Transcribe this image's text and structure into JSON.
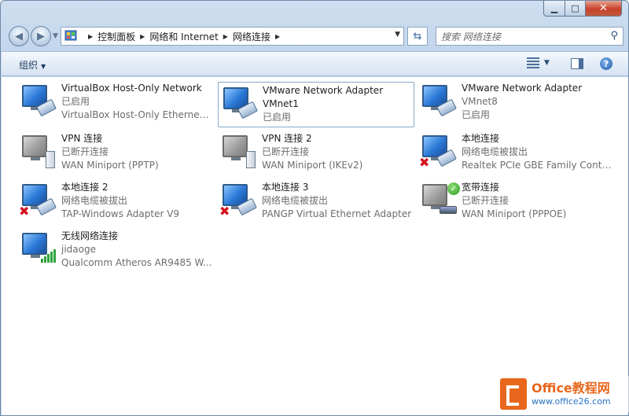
{
  "window": {
    "caption": {
      "minimize": "▁",
      "maximize": "□",
      "close": "✕"
    }
  },
  "navbar": {
    "back_icon": "◀",
    "forward_icon": "▶",
    "breadcrumb": [
      "控制面板",
      "网络和 Internet",
      "网络连接"
    ],
    "search_placeholder": "搜索 网络连接"
  },
  "toolbar": {
    "organize_label": "组织"
  },
  "connections": [
    {
      "name": "VirtualBox Host-Only Network",
      "status": "已启用",
      "device": "VirtualBox Host-Only Ethernet ...",
      "icon": "network-adapter-icon",
      "state": "enabled"
    },
    {
      "name": "VMware Network Adapter",
      "status": "VMnet1",
      "device": "已启用",
      "icon": "network-adapter-icon",
      "state": "enabled",
      "selected": true
    },
    {
      "name": "VMware Network Adapter",
      "status": "VMnet8",
      "device": "已启用",
      "icon": "network-adapter-icon",
      "state": "enabled"
    },
    {
      "name": "VPN 连接",
      "status": "已断开连接",
      "device": "WAN Miniport (PPTP)",
      "icon": "vpn-icon",
      "state": "disconnected"
    },
    {
      "name": "VPN 连接 2",
      "status": "已断开连接",
      "device": "WAN Miniport (IKEv2)",
      "icon": "vpn-icon",
      "state": "disconnected"
    },
    {
      "name": "本地连接",
      "status": "网络电缆被拔出",
      "device": "Realtek PCIe GBE Family Contr...",
      "icon": "network-adapter-icon",
      "state": "unplugged"
    },
    {
      "name": "本地连接 2",
      "status": "网络电缆被拔出",
      "device": "TAP-Windows Adapter V9",
      "icon": "network-adapter-icon",
      "state": "unplugged"
    },
    {
      "name": "本地连接 3",
      "status": "网络电缆被拔出",
      "device": "PANGP Virtual Ethernet Adapter",
      "icon": "network-adapter-icon",
      "state": "unplugged"
    },
    {
      "name": "宽带连接",
      "status": "已断开连接",
      "device": "WAN Miniport (PPPOE)",
      "icon": "broadband-icon",
      "state": "connected-check"
    },
    {
      "name": "无线网络连接",
      "status": "jidaoge",
      "device": "Qualcomm Atheros AR9485 W...",
      "icon": "wireless-icon",
      "state": "wireless"
    }
  ],
  "watermark": {
    "title": "Office教程网",
    "url": "www.office26.com"
  },
  "colors": {
    "accent": "#2a78d6",
    "error": "#d3131f",
    "ok": "#2d9a20",
    "brand": "#e8671d"
  }
}
